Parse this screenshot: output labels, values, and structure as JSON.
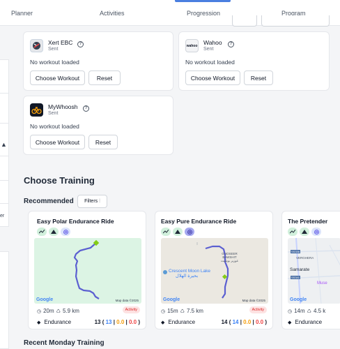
{
  "nav": {
    "tabs": [
      "Planner",
      "Activities",
      "Progression",
      "Program"
    ]
  },
  "devices": [
    {
      "name": "Xert EBC",
      "status": "Sent",
      "message": "No workout loaded",
      "choose_label": "Choose Workout",
      "reset_label": "Reset",
      "logo": "xert-logo"
    },
    {
      "name": "Wahoo",
      "status": "Sent",
      "message": "No workout loaded",
      "choose_label": "Choose Workout",
      "reset_label": "Reset",
      "logo": "wahoo-logo",
      "logo_text": "wahoo"
    },
    {
      "name": "MyWhoosh",
      "status": "Sent",
      "message": "No workout loaded",
      "choose_label": "Choose Workout",
      "reset_label": "Reset",
      "logo": "mywhoosh-logo"
    }
  ],
  "help_glyph": "?",
  "section": {
    "title": "Choose Training",
    "recommended": "Recommended",
    "filters_label": "Filters",
    "recent": "Recent Monday Training"
  },
  "workouts": [
    {
      "title": "Easy Polar Endurance Ride",
      "duration": "20m",
      "distance": "5.9 km",
      "badge": "Activity",
      "type": "Endurance",
      "score_total": "13",
      "score_a": "13",
      "score_b": "0.0",
      "score_c": "0.0",
      "map_data": "Map data ©2025",
      "google": "Google"
    },
    {
      "title": "Easy Pure Endurance Ride",
      "duration": "15m",
      "distance": "7.5 km",
      "badge": "Activity",
      "type": "Endurance",
      "score_total": "14",
      "score_a": "14",
      "score_b": "0.0",
      "score_c": "0.0",
      "map_data": "Map data ©2025",
      "google": "Google",
      "map_labels": {
        "area1": "GHOSEER",
        "area1b": "BAWSHIT",
        "area1c": "غوزير بوشيت",
        "lake": "Crescent Moon Lake",
        "lake_ar": "بحيرة الهلال"
      }
    },
    {
      "title": "The Pretender",
      "duration": "14m",
      "distance": "4.5 k",
      "type": "Endurance",
      "google": "Google",
      "map_labels": {
        "town": "VERGHERA",
        "city": "Samarate",
        "muse": "Muse",
        "road1": "SS336",
        "road2": "SS341"
      }
    }
  ],
  "colors": {
    "accent": "#4a7fe0",
    "route": "#6b6fd4",
    "map_green": "#dcf4e4",
    "map_beige": "#ebe8e1"
  }
}
